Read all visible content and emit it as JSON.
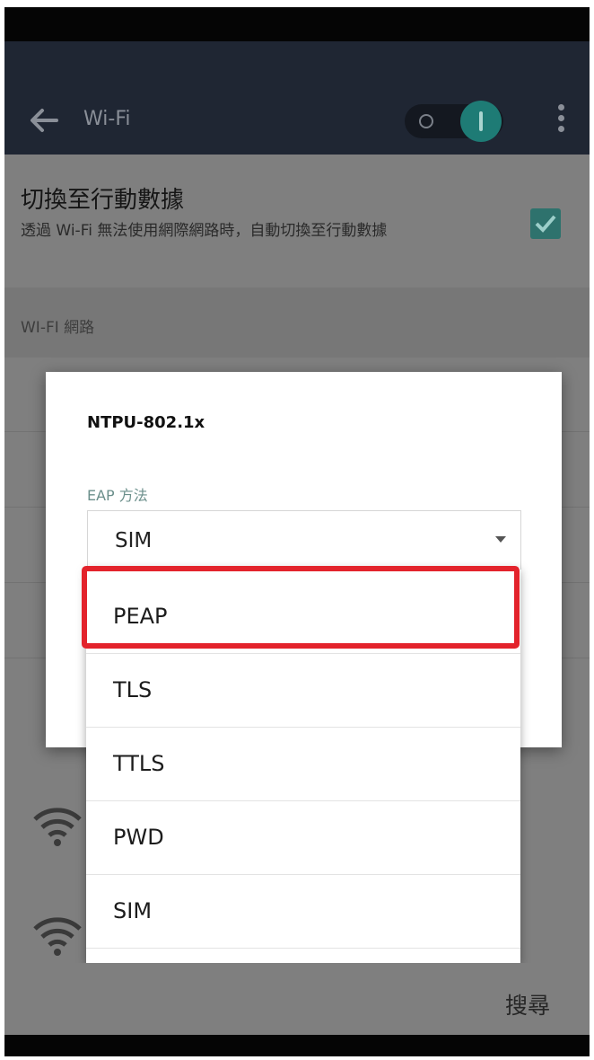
{
  "app_bar": {
    "title": "Wi-Fi",
    "icons": [
      "back-arrow-icon",
      "toggle-switch",
      "overflow-menu-icon"
    ]
  },
  "setting": {
    "title": "切換至行動數據",
    "summary": "透過 Wi-Fi 無法使用網際網路時，自動切換至行動數據",
    "checked": true
  },
  "section_header": "WI-FI 網路",
  "dialog": {
    "title": "NTPU-802.1x",
    "eap_label": "EAP 方法",
    "selected_value": "SIM"
  },
  "dropdown": {
    "options": [
      "PEAP",
      "TLS",
      "TTLS",
      "PWD",
      "SIM"
    ],
    "highlighted_option": "PEAP"
  },
  "bottom": {
    "search_label": "搜尋"
  },
  "colors": {
    "accent": "#1e7b75",
    "highlight_box": "#e3232c",
    "app_bar": "#1f2633"
  }
}
